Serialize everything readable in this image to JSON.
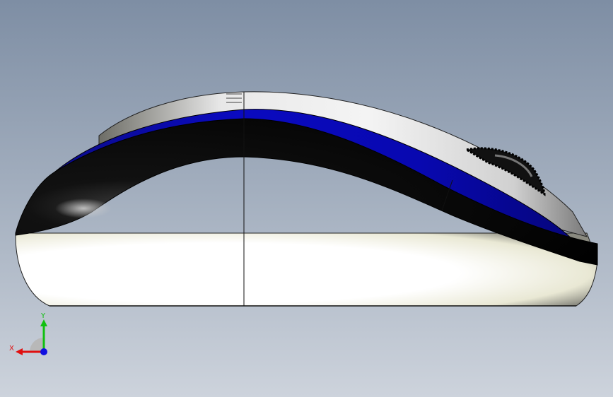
{
  "viewport": {
    "background_top": "#7e8ea4",
    "background_bottom": "#cdd3dc"
  },
  "model": {
    "name": "mouse-side-view",
    "colors": {
      "shell": "#ffffff",
      "shell_shade": "#d8d8c8",
      "stripe_blue": "#0a0ab4",
      "band_black": "#050505",
      "wheel": "#111111"
    }
  },
  "triad": {
    "x_label": "X",
    "y_label": "Y",
    "x_color": "#e01010",
    "y_color": "#10c010",
    "z_color": "#1010e0"
  }
}
